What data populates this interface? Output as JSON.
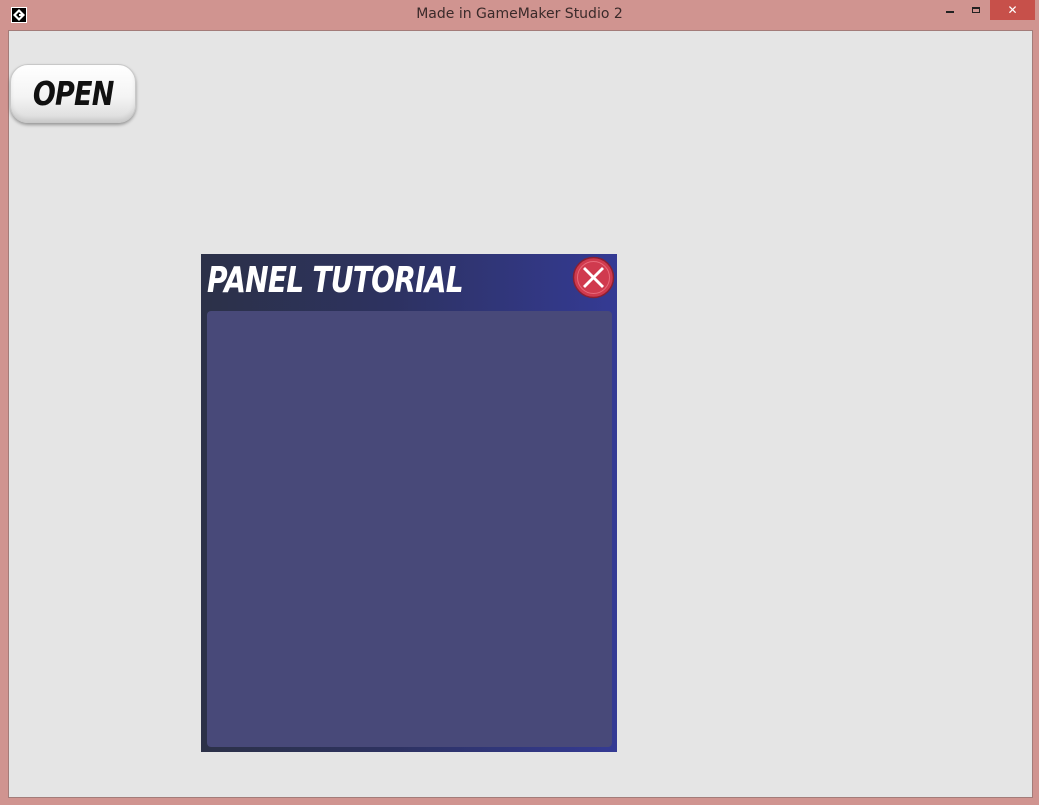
{
  "window": {
    "title": "Made in GameMaker Studio 2",
    "close_glyph": "✕",
    "accent_close": "#c7504a",
    "frame_color": "#d09490"
  },
  "app_icon": "gamemaker-icon",
  "open_button": {
    "label": "OPEN",
    "icon": null
  },
  "panel": {
    "title": "PANEL TUTORIAL",
    "close_icon": "close-x-circle-icon",
    "colors": {
      "header_gradient_start": "#2c3148",
      "header_gradient_end": "#343a94",
      "body": "#484979",
      "close_red": "#d03a4e"
    }
  }
}
